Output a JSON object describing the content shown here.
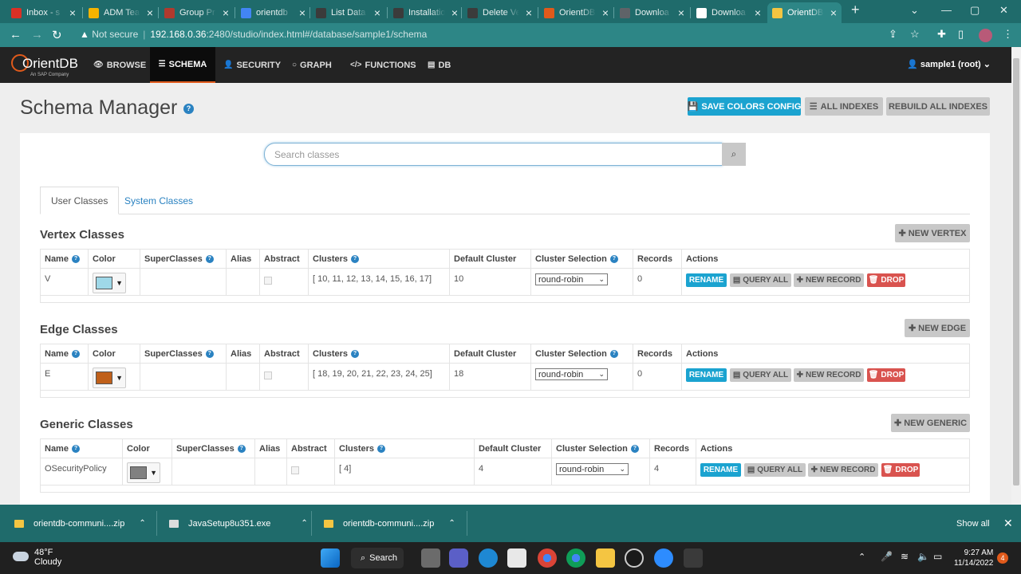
{
  "browser": {
    "tabs": [
      {
        "title": "Inbox - s",
        "favicon": "gmail-icon",
        "color": "#d93025"
      },
      {
        "title": "ADM Tea",
        "favicon": "slides-icon",
        "color": "#f4b400"
      },
      {
        "title": "Group Pr",
        "favicon": "doc-icon",
        "color": "#b03a2e"
      },
      {
        "title": "orientdb",
        "favicon": "google-icon",
        "color": "#4285f4"
      },
      {
        "title": "List Data",
        "favicon": "orientdb-doc-icon",
        "color": "#3b3b3b"
      },
      {
        "title": "Installatio",
        "favicon": "orientdb-doc-icon",
        "color": "#3b3b3b"
      },
      {
        "title": "Delete Ve",
        "favicon": "orientdb-doc-icon",
        "color": "#3b3b3b"
      },
      {
        "title": "OrientDB",
        "favicon": "orientdb-icon",
        "color": "#e05a1b"
      },
      {
        "title": "Downloa",
        "favicon": "page-icon",
        "color": "#5f6368"
      },
      {
        "title": "Downloa",
        "favicon": "page-icon",
        "color": "#ffffff"
      },
      {
        "title": "OrientDB",
        "favicon": "orientdb-icon",
        "color": "#f4c542",
        "active": true
      }
    ],
    "url_prefix": "Not secure",
    "url_host": "192.168.0.36",
    "url_rest": ":2480/studio/index.html#/database/sample1/schema"
  },
  "nav": {
    "logo_text": "OrientDB",
    "logo_sub": "An SAP Company",
    "items": [
      {
        "label": "BROWSE",
        "icon": "eye-icon",
        "glyph": "👁"
      },
      {
        "label": "SCHEMA",
        "icon": "list-icon",
        "glyph": "☰",
        "active": true
      },
      {
        "label": "SECURITY",
        "icon": "user-icon",
        "glyph": "👤"
      },
      {
        "label": "GRAPH",
        "icon": "circle-icon",
        "glyph": "○"
      },
      {
        "label": "FUNCTIONS",
        "icon": "code-icon",
        "glyph": "</>"
      },
      {
        "label": "DB",
        "icon": "database-icon",
        "glyph": "▤"
      }
    ],
    "user": "sample1 (root)"
  },
  "header": {
    "title": "Schema Manager",
    "save_colors": "SAVE COLORS CONFIG",
    "all_indexes": "ALL INDEXES",
    "rebuild_indexes": "REBUILD ALL INDEXES"
  },
  "search": {
    "placeholder": "Search classes"
  },
  "tabs": {
    "user": "User Classes",
    "system": "System Classes"
  },
  "columns": {
    "name": "Name",
    "color": "Color",
    "superclasses": "SuperClasses",
    "alias": "Alias",
    "abstract": "Abstract",
    "clusters": "Clusters",
    "default_cluster": "Default Cluster",
    "cluster_selection": "Cluster Selection",
    "records": "Records",
    "actions": "Actions"
  },
  "actions": {
    "rename": "RENAME",
    "query_all": "QUERY ALL",
    "new_record": "NEW RECORD",
    "drop": "DROP"
  },
  "vertex": {
    "title": "Vertex Classes",
    "new_button": "NEW VERTEX",
    "rows": [
      {
        "name": "V",
        "color": "#9fd8e8",
        "clusters": "[ 10, 11, 12, 13, 14, 15, 16, 17]",
        "default_cluster": "10",
        "selection": "round-robin",
        "records": "0"
      }
    ]
  },
  "edge": {
    "title": "Edge Classes",
    "new_button": "NEW EDGE",
    "rows": [
      {
        "name": "E",
        "color": "#c0601a",
        "clusters": "[ 18, 19, 20, 21, 22, 23, 24, 25]",
        "default_cluster": "18",
        "selection": "round-robin",
        "records": "0"
      }
    ]
  },
  "generic": {
    "title": "Generic Classes",
    "new_button": "NEW GENERIC",
    "rows": [
      {
        "name": "OSecurityPolicy",
        "color": "#808080",
        "clusters": "[ 4]",
        "default_cluster": "4",
        "selection": "round-robin",
        "records": "4"
      }
    ]
  },
  "downloads": {
    "items": [
      "orientdb-communi....zip",
      "JavaSetup8u351.exe",
      "orientdb-communi....zip"
    ],
    "show_all": "Show all"
  },
  "taskbar": {
    "temp": "48°F",
    "weather": "Cloudy",
    "search": "Search",
    "time": "9:27 AM",
    "date": "11/14/2022",
    "badge": "4"
  }
}
